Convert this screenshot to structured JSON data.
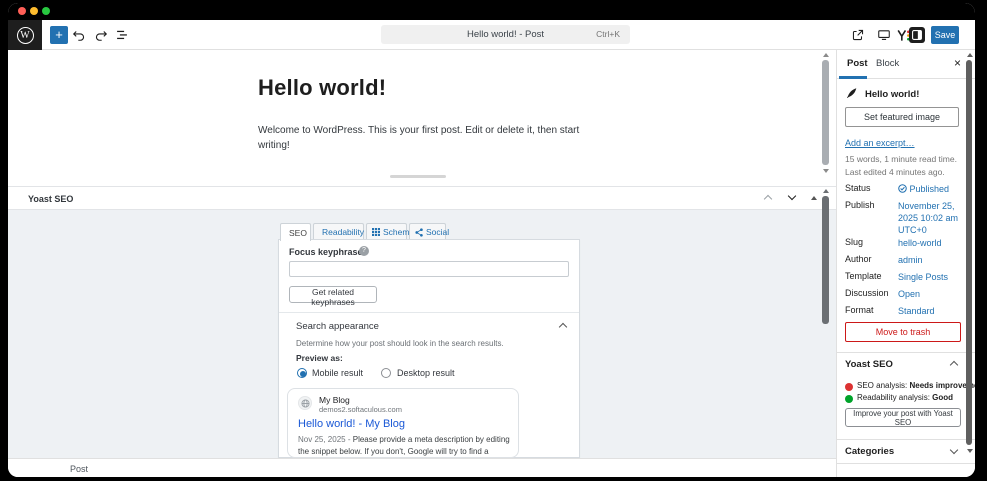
{
  "header": {
    "document_title": "Hello world! - Post",
    "shortcut": "Ctrl+K",
    "save_label": "Save"
  },
  "post": {
    "title": "Hello world!",
    "body": "Welcome to WordPress. This is your first post. Edit or delete it, then start writing!"
  },
  "metabox": {
    "title": "Yoast SEO",
    "tabs": [
      {
        "label": "SEO"
      },
      {
        "label": "Readability"
      },
      {
        "label": "Schema"
      },
      {
        "label": "Social"
      }
    ],
    "focus_keyphrase_label": "Focus keyphrase",
    "get_related_keyphrases": "Get related keyphrases",
    "search_appearance": {
      "title": "Search appearance",
      "description": "Determine how your post should look in the search results.",
      "preview_as": "Preview as:",
      "mobile_option": "Mobile result",
      "desktop_option": "Desktop result"
    },
    "snippet_preview": {
      "site_name": "My Blog",
      "site_url": "demos2.softaculous.com",
      "title": "Hello world! - My Blog",
      "date": "Nov 25, 2025",
      "separator": "-",
      "description": "Please provide a meta description by editing the snippet below. If you don't, Google will try to find a relevant part of your post to show in the search results."
    }
  },
  "footer": {
    "breadcrumb": "Post"
  },
  "sidebar": {
    "tabs": {
      "post": "Post",
      "block": "Block"
    },
    "summary_title": "Hello world!",
    "set_featured_image": "Set featured image",
    "add_excerpt": "Add an excerpt…",
    "word_count": "15 words, 1 minute read time.",
    "last_edited": "Last edited 4 minutes ago.",
    "fields": [
      {
        "label": "Status",
        "value": "Published"
      },
      {
        "label": "Publish",
        "value": "November 25, 2025 10:02 am UTC+0"
      },
      {
        "label": "Slug",
        "value": "hello-world"
      },
      {
        "label": "Author",
        "value": "admin"
      },
      {
        "label": "Template",
        "value": "Single Posts"
      },
      {
        "label": "Discussion",
        "value": "Open"
      },
      {
        "label": "Format",
        "value": "Standard"
      }
    ],
    "move_to_trash": "Move to trash",
    "yoast": {
      "title": "Yoast SEO",
      "seo_label": "SEO analysis:",
      "seo_value": "Needs improvement",
      "readability_label": "Readability analysis:",
      "readability_value": "Good",
      "improve_button": "Improve your post with Yoast SEO"
    },
    "categories_title": "Categories"
  },
  "colors": {
    "accent": "#2271b1",
    "yoast_red": "#dc3232",
    "yoast_green": "#00a32a",
    "trash_red": "#cc1818",
    "google_link_blue": "#1a58d6"
  }
}
